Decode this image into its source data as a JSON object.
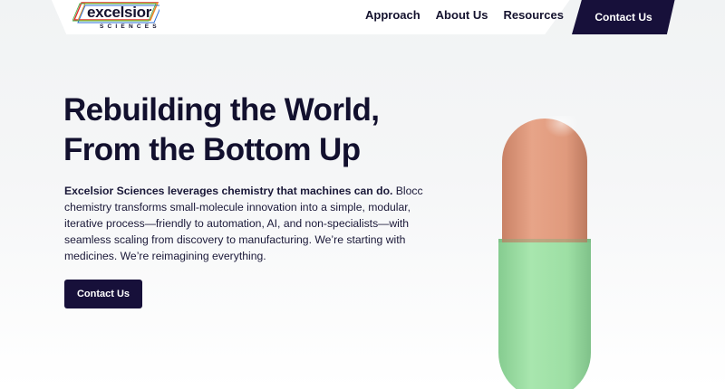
{
  "header": {
    "logo": {
      "wordmark": "excelsior",
      "subtitle": "SCIENCES",
      "colors": [
        "#e0322f",
        "#f29a1f",
        "#2f6fd6",
        "#4bb24a"
      ]
    },
    "nav": [
      {
        "label": "Approach"
      },
      {
        "label": "About Us"
      },
      {
        "label": "Resources"
      }
    ],
    "cta_label": "Contact Us"
  },
  "hero": {
    "title_line1": "Rebuilding the World,",
    "title_line2": "From the Bottom Up",
    "body_bold": "Excelsior Sciences leverages chemistry that machines can do.",
    "body_rest": " Blocc chemistry transforms small-molecule innovation into a simple, modular, iterative process—friendly to automation, AI, and non-specialists—with seamless scaling from discovery to manufacturing. We’re starting with medicines. We’re reimagining everything.",
    "cta_label": "Contact Us"
  },
  "colors": {
    "navy": "#17103a",
    "capsule_top": "#e39d80",
    "capsule_bottom": "#9edfa6"
  }
}
